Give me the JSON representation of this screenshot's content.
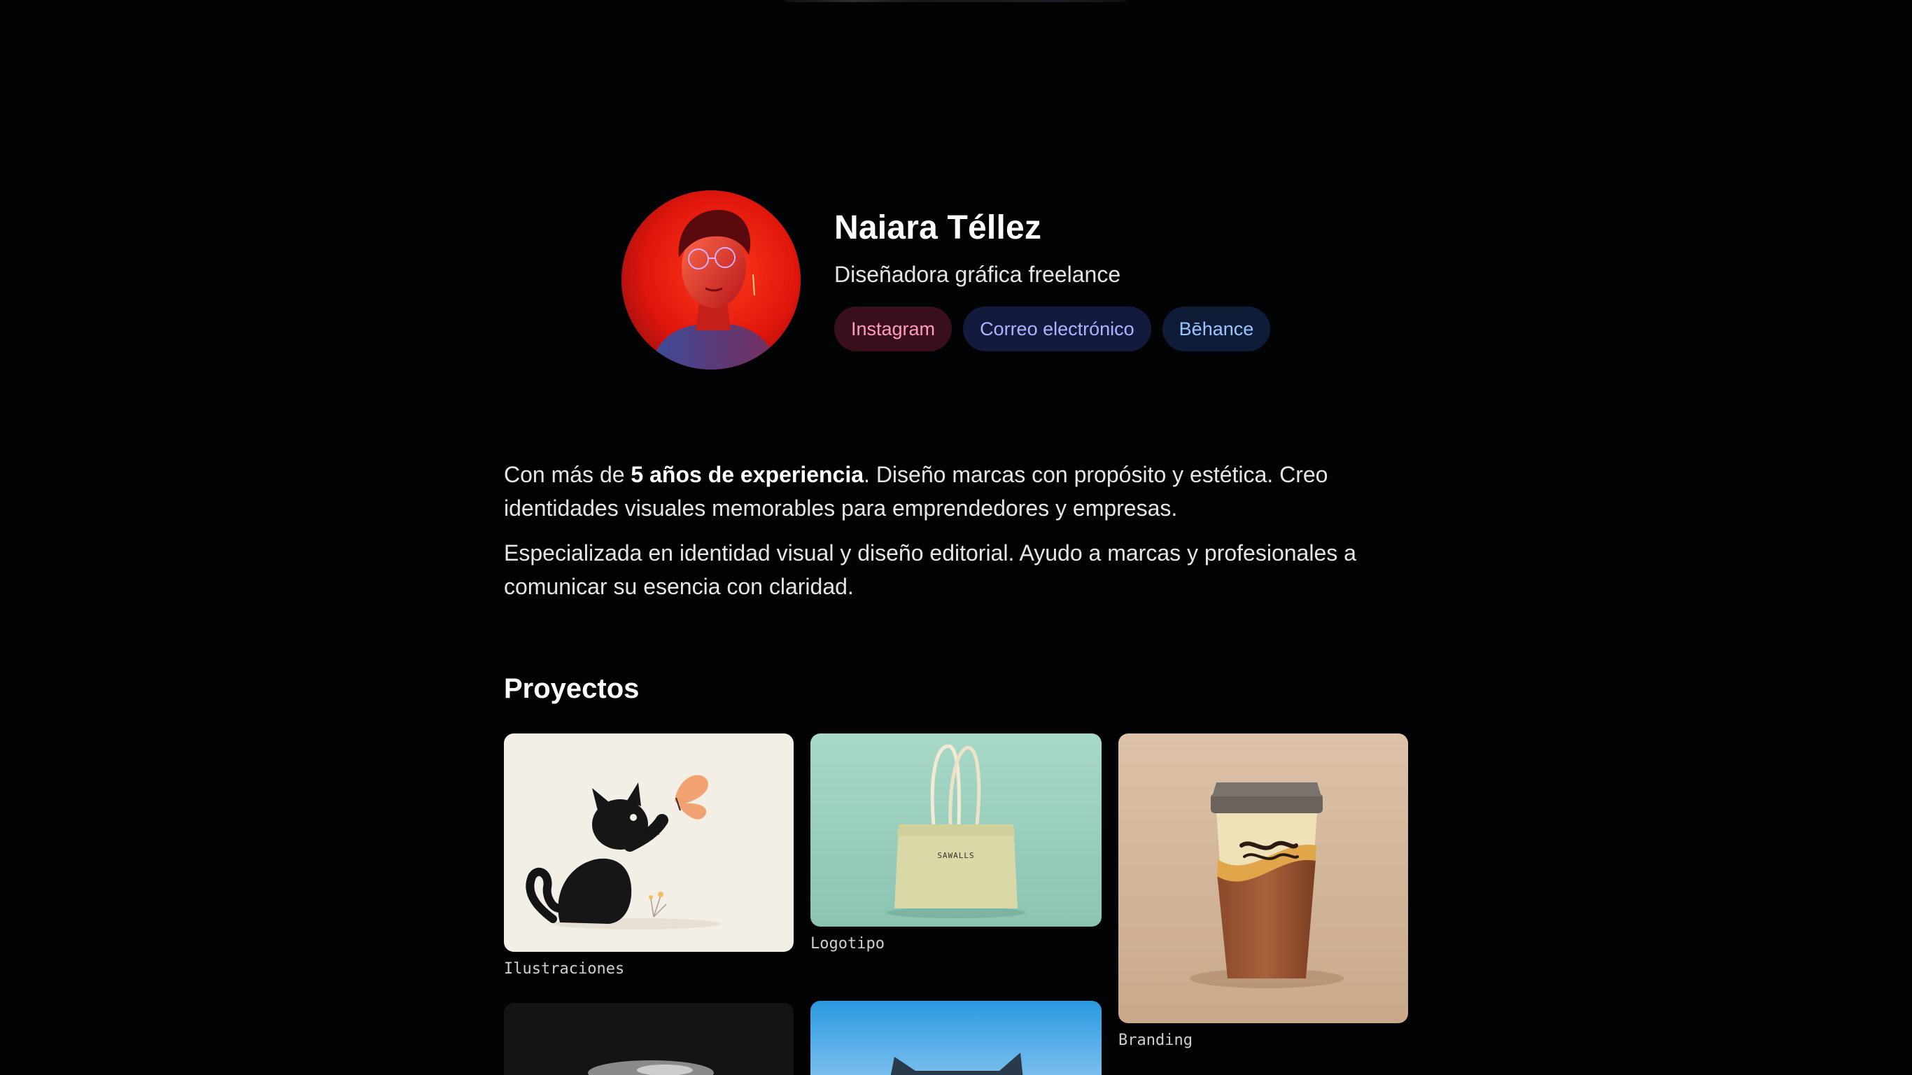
{
  "profile": {
    "name": "Naiara Téllez",
    "role": "Diseñadora gráfica freelance",
    "links": [
      {
        "label": "Instagram",
        "icon": "instagram-link"
      },
      {
        "label": "Correo electrónico",
        "icon": "email-link"
      },
      {
        "label": "Bēhance",
        "icon": "behance-link"
      }
    ]
  },
  "bio": {
    "p1_before": "Con más de ",
    "p1_bold": "5 años de experiencia",
    "p1_after": ". Diseño marcas con propósito y estética. Creo identidades visuales memorables para emprendedores y empresas.",
    "p2": "Especializada en identidad visual y diseño editorial. Ayudo a marcas y profesionales a comunicar su esencia con claridad."
  },
  "projects": {
    "title": "Proyectos",
    "items": [
      {
        "label": "Ilustraciones",
        "image": "cat-and-butterfly-illustration"
      },
      {
        "label": "Logotipo",
        "image": "tote-bag-mockup",
        "bag_text": "SAWALLS"
      },
      {
        "label": "Branding",
        "image": "coffee-cup-mockup"
      },
      {
        "label": "",
        "image": "monochrome-photo"
      },
      {
        "label": "",
        "image": "cat-silhouette-sky"
      }
    ]
  },
  "colors": {
    "background": "#020304",
    "instagram_chip_bg": "#3a0f1c",
    "instagram_chip_text": "#ff9cc2",
    "email_chip_bg": "#141a3c",
    "email_chip_text": "#a8b6ff",
    "behance_chip_bg": "#0f1c38",
    "behance_chip_text": "#9cc4ff"
  }
}
